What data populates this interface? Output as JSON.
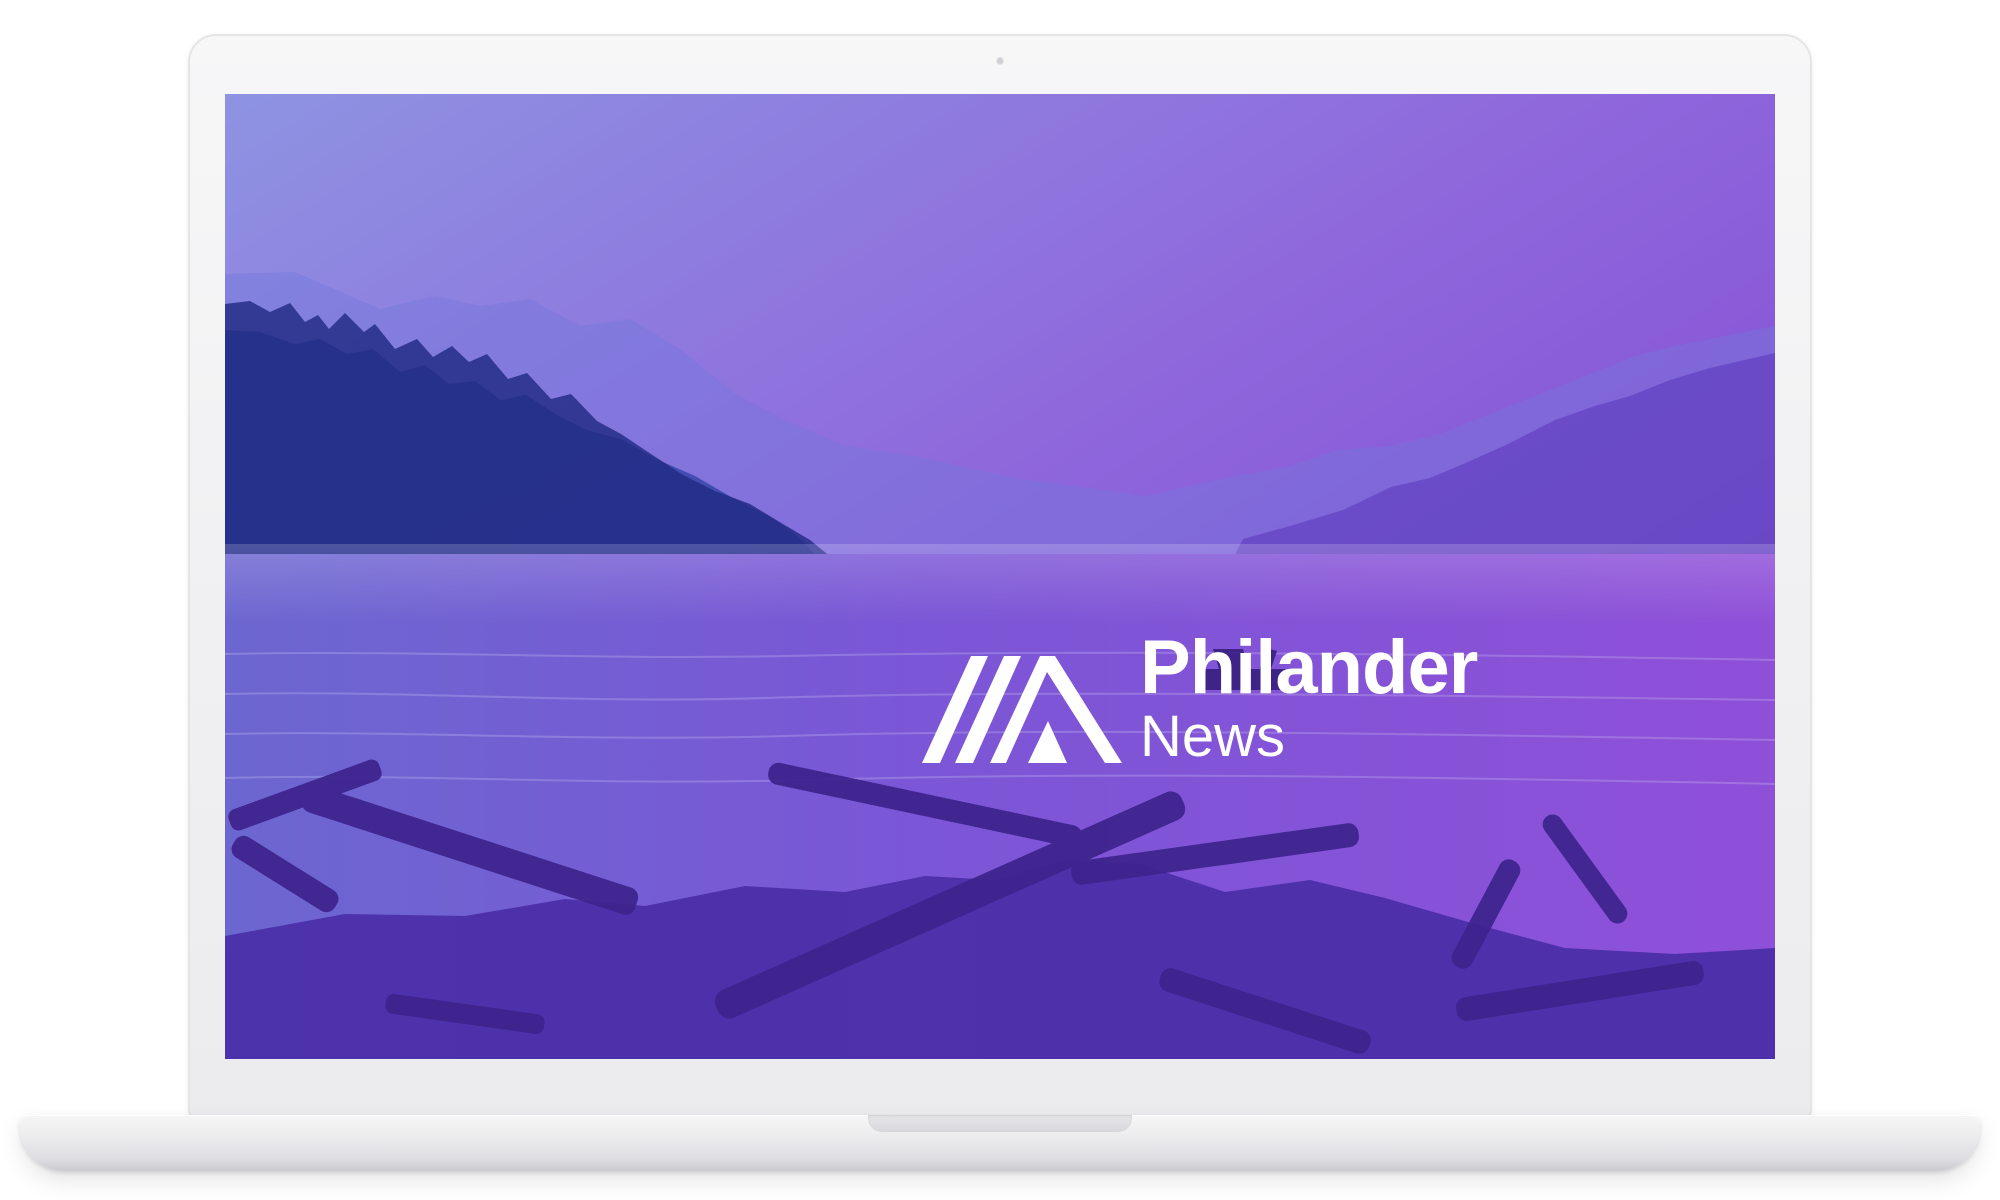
{
  "brand": {
    "title": "Philander",
    "subtitle": "News"
  },
  "icons": {
    "logo": "mountain-logo-icon",
    "camera": "camera-icon"
  },
  "colors": {
    "overlay_start": "#8a8bdf",
    "overlay_mid": "#8a63d9",
    "overlay_end": "#7d3ed0",
    "logo": "#ffffff"
  }
}
